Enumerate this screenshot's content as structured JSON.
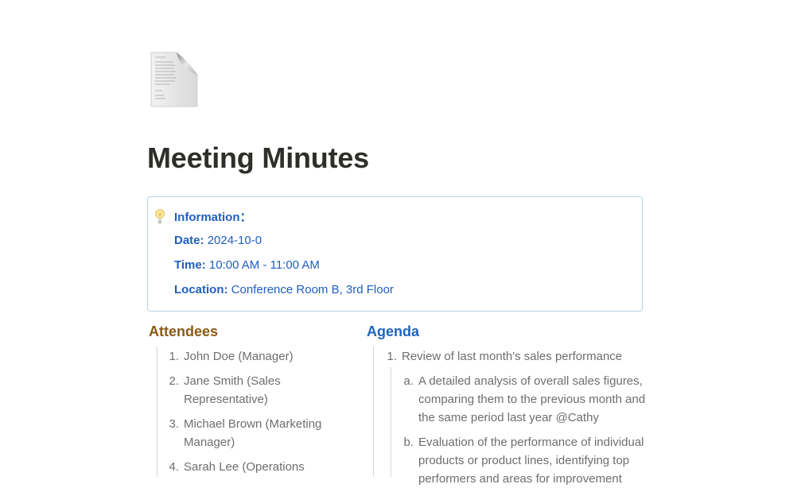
{
  "page": {
    "icon": "document-page-icon",
    "title": "Meeting Minutes"
  },
  "callout": {
    "icon": "lightbulb-icon",
    "heading": "Information：",
    "date_label": "Date:",
    "date_value": "2024-10-0",
    "time_label": "Time:",
    "time_value": "10:00 AM - 11:00 AM",
    "location_label": "Location:",
    "location_value": "Conference Room B, 3rd Floor"
  },
  "attendees": {
    "heading": "Attendees",
    "items": [
      {
        "num": "1.",
        "lines": [
          "John Doe (Manager)"
        ]
      },
      {
        "num": "2.",
        "lines": [
          "Jane Smith (Sales",
          "Representative)"
        ]
      },
      {
        "num": "3.",
        "lines": [
          "Michael Brown (Marketing",
          "Manager)"
        ]
      },
      {
        "num": "4.",
        "lines": [
          "Sarah Lee (Operations"
        ]
      }
    ]
  },
  "agenda": {
    "heading": "Agenda",
    "item1": {
      "num": "1.",
      "text": "Review of last month's sales performance"
    },
    "subitems": [
      {
        "num": "a.",
        "lines": [
          "A detailed analysis of overall sales figures,",
          "comparing them to the previous month and",
          "the same period last year @Cathy"
        ]
      },
      {
        "num": "b.",
        "lines": [
          "Evaluation of the performance of individual",
          "products or product lines, identifying top",
          "performers and areas for improvement"
        ]
      }
    ]
  },
  "colors": {
    "callout_border": "#b6d3e6",
    "callout_text": "#1f5fbf",
    "attendees_heading": "#8a5a14",
    "agenda_heading": "#1f65bf",
    "body_text": "#6e6e6e"
  }
}
